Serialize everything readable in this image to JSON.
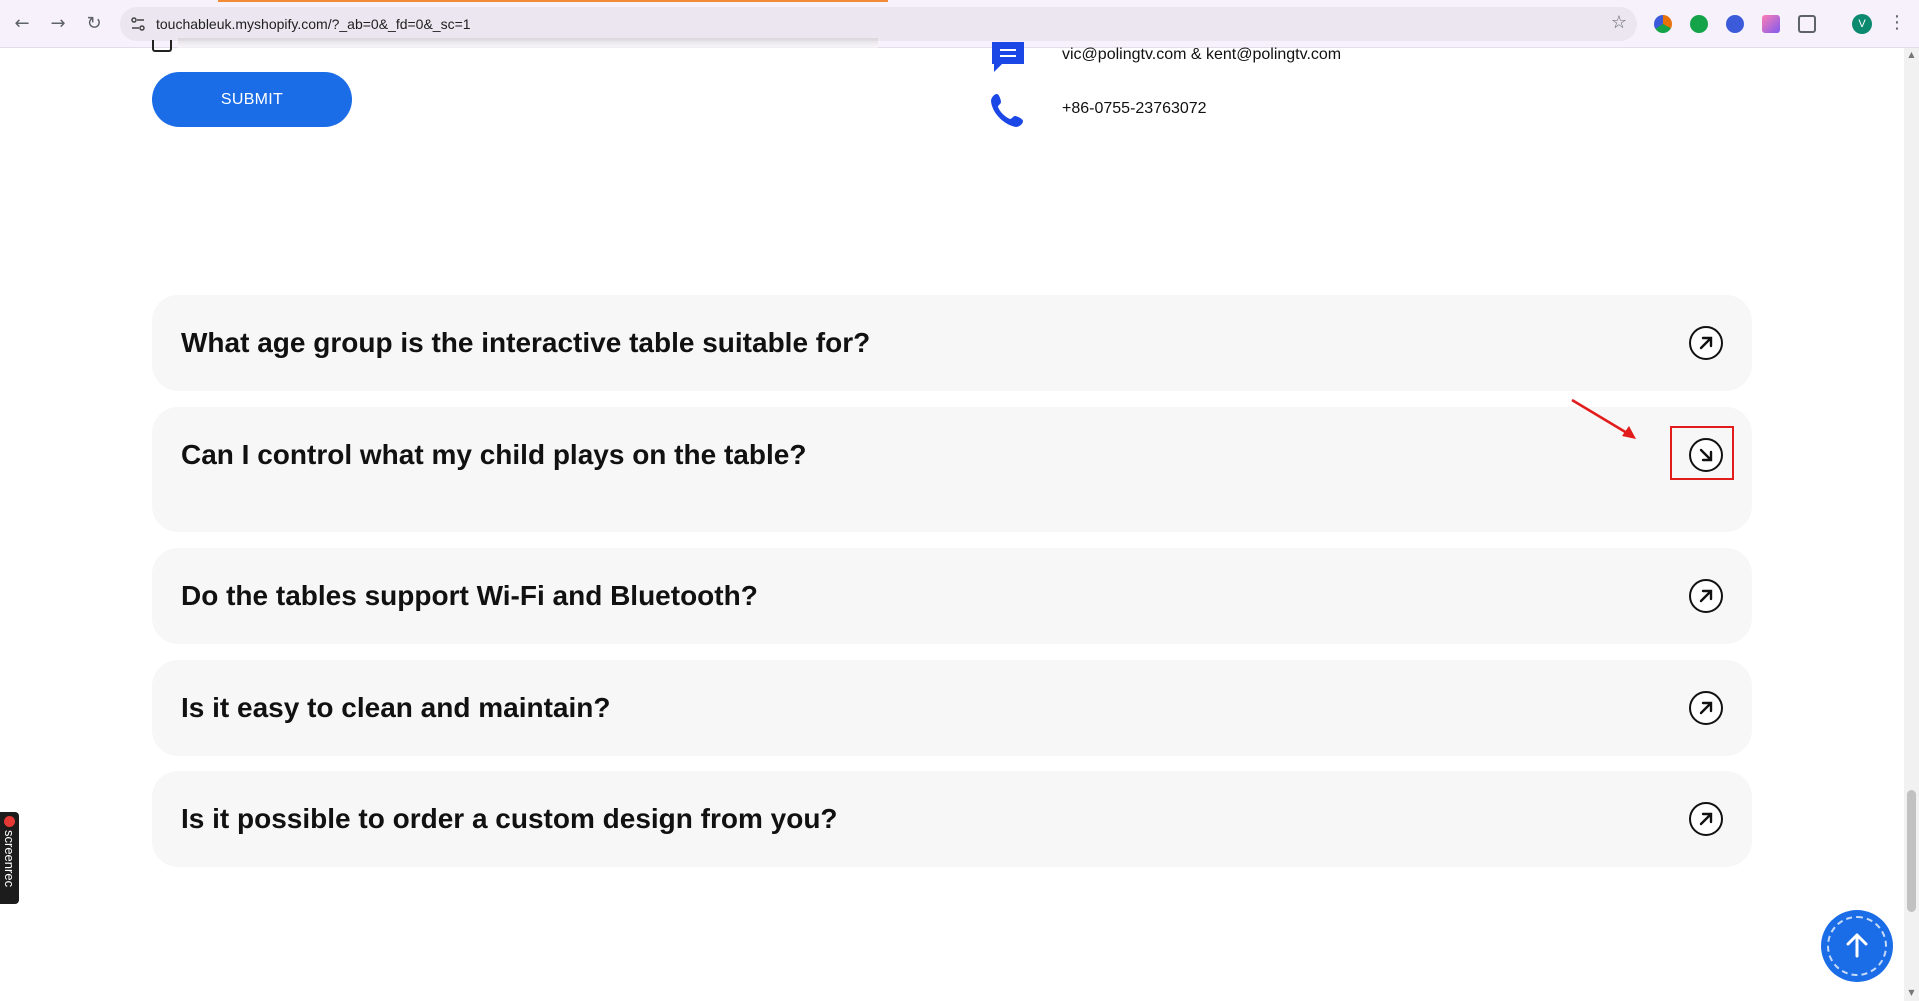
{
  "browser": {
    "url": "touchableuk.myshopify.com/?_ab=0&_fd=0&_sc=1",
    "avatar_initial": "V",
    "extension_colors": [
      "#e8710a",
      "#15a34a",
      "#3b5bdb",
      "#e64980",
      "#5f6368"
    ]
  },
  "form": {
    "submit_label": "SUBMIT"
  },
  "contact": {
    "email": "vic@polingtv.com & kent@polingtv.com",
    "phone": "+86-0755-23763072",
    "icon_color": "#1a47e6"
  },
  "faq": {
    "items": [
      {
        "question": "What age group is the interactive table suitable for?",
        "state": "collapsed"
      },
      {
        "question": "Can I control what my child plays on the table?",
        "state": "expanded"
      },
      {
        "question": "Do the tables support Wi-Fi and Bluetooth?",
        "state": "collapsed"
      },
      {
        "question": "Is it easy to clean and maintain?",
        "state": "collapsed"
      },
      {
        "question": "Is it possible to order a custom design from you?",
        "state": "collapsed"
      }
    ]
  },
  "overlays": {
    "screenrec_label": "screenrec",
    "accent_color": "#1a6de6",
    "annotation_color": "#e21b1b"
  }
}
